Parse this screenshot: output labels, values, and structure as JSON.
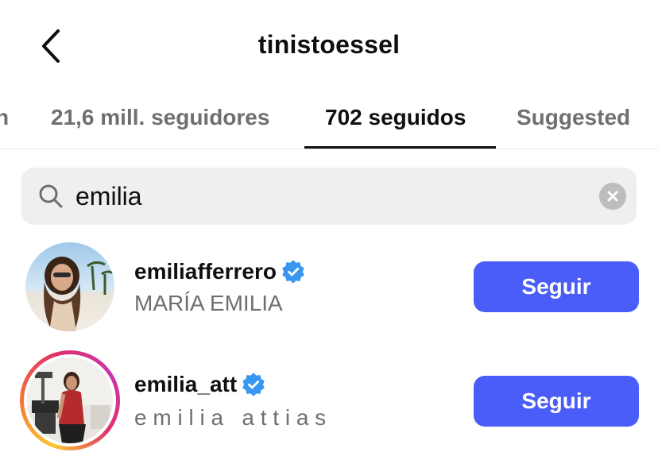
{
  "header": {
    "title": "tinistoessel",
    "back_icon": "chevron-left-icon"
  },
  "tabs": [
    {
      "label": "n"
    },
    {
      "label": "21,6 mill. seguidores"
    },
    {
      "label": "702 seguidos",
      "active": true
    },
    {
      "label": "Suggested"
    }
  ],
  "search": {
    "value": "emilia",
    "icon": "search-icon",
    "clear_icon": "clear-icon"
  },
  "results": [
    {
      "username": "emiliafferrero",
      "full_name": "MARÍA EMILIA",
      "verified": true,
      "has_story_ring": false,
      "button_label": "Seguir"
    },
    {
      "username": "emilia_att",
      "full_name": "e m i l i a   a t t i a s",
      "verified": true,
      "has_story_ring": true,
      "button_label": "Seguir"
    }
  ],
  "colors": {
    "accent": "#4a5df9",
    "verified": "#3897f0",
    "secondary_text": "#6f6f73",
    "search_bg": "#efeff0",
    "story_ring_start": "#fdc830",
    "story_ring_end": "#c837ab"
  }
}
